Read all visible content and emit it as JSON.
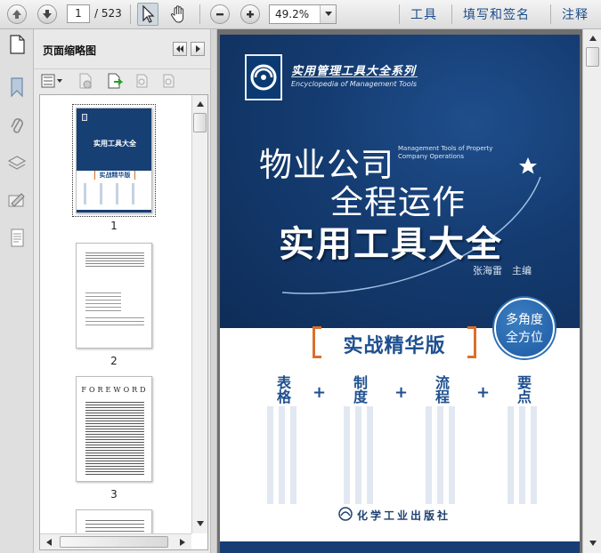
{
  "toolbar": {
    "current_page": "1",
    "total_pages": "/ 523",
    "zoom": "49.2%",
    "menu": {
      "tools": "工具",
      "fill_sign": "填写和签名",
      "comment": "注释"
    }
  },
  "side_panel": {
    "title": "页面缩略图",
    "thumbnails": [
      {
        "label": "1",
        "selected": true
      },
      {
        "label": "2",
        "selected": false
      },
      {
        "label": "3",
        "selected": false
      }
    ],
    "thumb3_heading": "FOREWORD",
    "thumb1_title": "实用工具大全",
    "thumb1_badge": "实战精华版"
  },
  "document": {
    "series_cn": "实用管理工具大全系列",
    "series_en": "Encyclopedia of Management Tools",
    "title_line1": "物业公司",
    "title_line2": "全程运作",
    "title_line3": "实用工具大全",
    "title_en": "Management Tools of Property Company Operations",
    "author": "张海雷　主编",
    "badge_line1": "多角度",
    "badge_line2": "全方位",
    "edition": "实战精华版",
    "columns": [
      "表格",
      "制度",
      "流程",
      "要点"
    ],
    "plus": "+",
    "publisher": "化学工业出版社"
  },
  "colors": {
    "cover_blue": "#143b70",
    "title_blue": "#1e4f8f",
    "accent_orange": "#d8702c",
    "link_blue": "#1b4d8a"
  }
}
